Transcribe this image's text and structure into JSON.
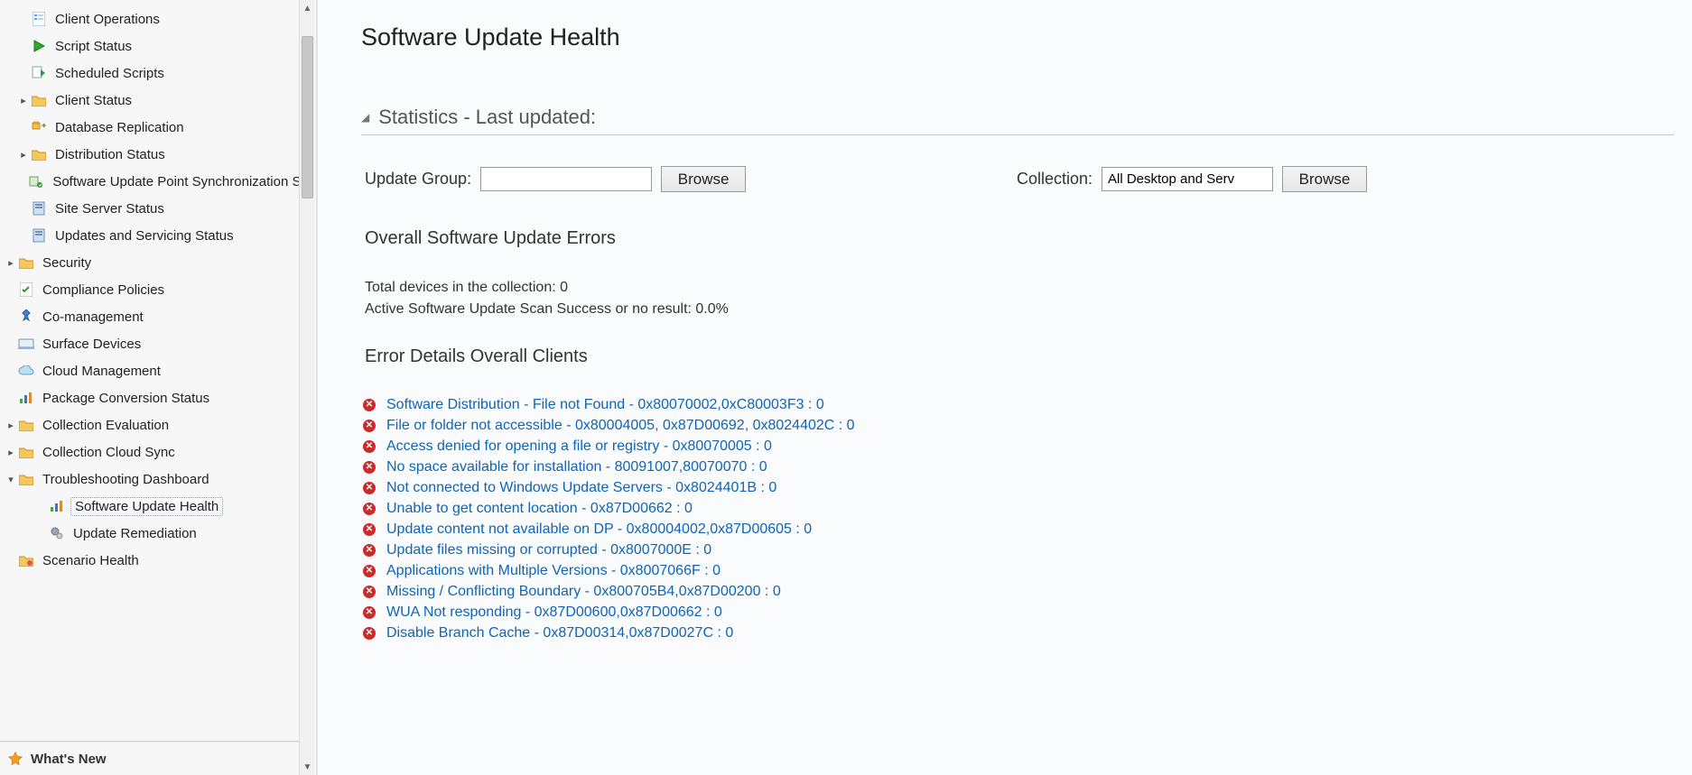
{
  "sidebar": {
    "items": [
      {
        "label": "Client Operations",
        "icon": "doc-checklist",
        "indent": 1,
        "expand": ""
      },
      {
        "label": "Script Status",
        "icon": "play-green",
        "indent": 1,
        "expand": ""
      },
      {
        "label": "Scheduled Scripts",
        "icon": "script-arrow",
        "indent": 1,
        "expand": ""
      },
      {
        "label": "Client Status",
        "icon": "folder",
        "indent": 1,
        "expand": "▸"
      },
      {
        "label": "Database Replication",
        "icon": "db-swap",
        "indent": 1,
        "expand": ""
      },
      {
        "label": "Distribution Status",
        "icon": "folder",
        "indent": 1,
        "expand": "▸"
      },
      {
        "label": "Software Update Point Synchronization Sta",
        "icon": "sync-point",
        "indent": 1,
        "expand": ""
      },
      {
        "label": "Site Server Status",
        "icon": "server",
        "indent": 1,
        "expand": ""
      },
      {
        "label": "Updates and Servicing Status",
        "icon": "server",
        "indent": 1,
        "expand": ""
      },
      {
        "label": "Security",
        "icon": "folder",
        "indent": 0,
        "expand": "▸"
      },
      {
        "label": "Compliance Policies",
        "icon": "doc-check",
        "indent": 0,
        "expand": ""
      },
      {
        "label": "Co-management",
        "icon": "pin-blue",
        "indent": 0,
        "expand": ""
      },
      {
        "label": "Surface Devices",
        "icon": "surface",
        "indent": 0,
        "expand": ""
      },
      {
        "label": "Cloud Management",
        "icon": "cloud",
        "indent": 0,
        "expand": ""
      },
      {
        "label": "Package Conversion Status",
        "icon": "bars",
        "indent": 0,
        "expand": ""
      },
      {
        "label": "Collection Evaluation",
        "icon": "folder",
        "indent": 0,
        "expand": "▸"
      },
      {
        "label": "Collection Cloud Sync",
        "icon": "folder",
        "indent": 0,
        "expand": "▸"
      },
      {
        "label": "Troubleshooting Dashboard",
        "icon": "folder",
        "indent": 0,
        "expand": "▾"
      },
      {
        "label": "Software Update Health",
        "icon": "bars",
        "indent": 2,
        "expand": "",
        "selected": true
      },
      {
        "label": "Update Remediation",
        "icon": "gears",
        "indent": 2,
        "expand": ""
      },
      {
        "label": "Scenario Health",
        "icon": "folder-heart",
        "indent": 0,
        "expand": ""
      }
    ],
    "footer": {
      "label": "What's New",
      "icon": "star-orange"
    }
  },
  "header": {
    "title": "Software Update Health"
  },
  "section": {
    "title": "Statistics - Last updated:"
  },
  "filters": {
    "update_group_label": "Update Group:",
    "update_group_value": "",
    "browse1": "Browse",
    "collection_label": "Collection:",
    "collection_value": "All Desktop and Serv",
    "browse2": "Browse"
  },
  "stats": {
    "overall_heading": "Overall Software Update Errors",
    "total_devices": "Total devices in the collection: 0",
    "scan_success": "Active Software Update Scan Success or no result: 0.0%"
  },
  "errors": {
    "heading": "Error Details Overall Clients",
    "items": [
      "Software Distribution - File not Found - 0x80070002,0xC80003F3 : 0",
      "File or folder not accessible - 0x80004005, 0x87D00692, 0x8024402C : 0",
      "Access denied for opening a file or registry - 0x80070005 : 0",
      "No space available for installation - 80091007,80070070 : 0",
      "Not connected to Windows Update Servers - 0x8024401B  : 0",
      "Unable to get content location - 0x87D00662  : 0",
      "Update content not available on DP - 0x80004002,0x87D00605 : 0",
      "Update files missing or corrupted - 0x8007000E : 0",
      "Applications with Multiple Versions - 0x8007066F : 0",
      "Missing / Conflicting Boundary - 0x800705B4,0x87D00200 : 0",
      "WUA Not responding - 0x87D00600,0x87D00662 : 0",
      "Disable Branch Cache - 0x87D00314,0x87D0027C : 0"
    ]
  }
}
